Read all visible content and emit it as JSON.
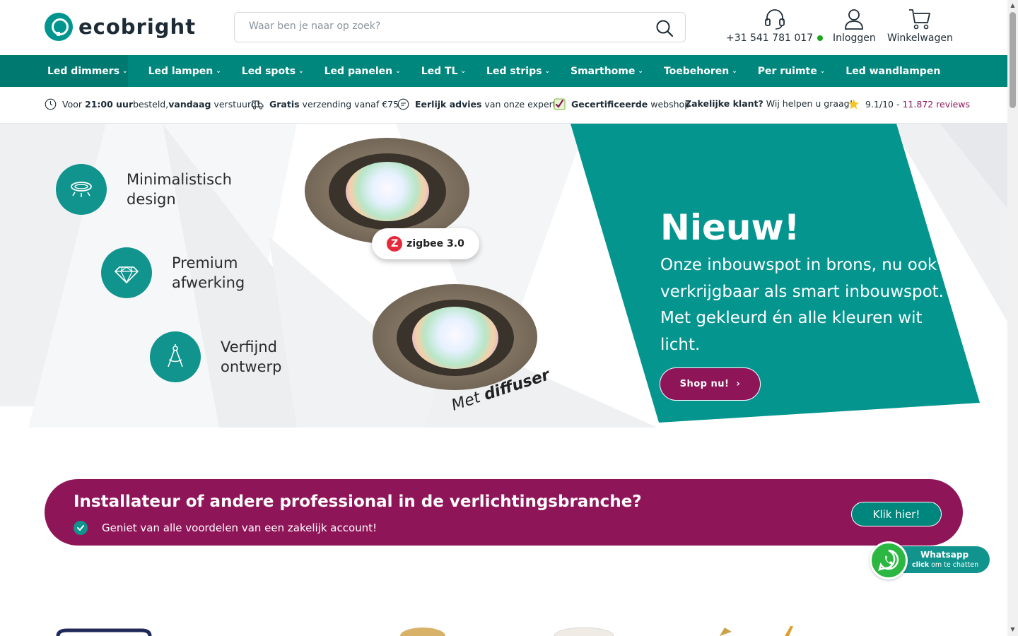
{
  "header": {
    "logo_text": "ecobright",
    "search_placeholder": "Waar ben je naar op zoek?",
    "phone": "+31 541 781 017",
    "login_label": "Inloggen",
    "cart_label": "Winkelwagen"
  },
  "nav": {
    "items": [
      {
        "label": "Led dimmers",
        "has_dropdown": true
      },
      {
        "label": "Led lampen",
        "has_dropdown": true
      },
      {
        "label": "Led spots",
        "has_dropdown": true
      },
      {
        "label": "Led panelen",
        "has_dropdown": true
      },
      {
        "label": "Led TL",
        "has_dropdown": true
      },
      {
        "label": "Led strips",
        "has_dropdown": true
      },
      {
        "label": "Smarthome",
        "has_dropdown": true
      },
      {
        "label": "Toebehoren",
        "has_dropdown": true
      },
      {
        "label": "Per ruimte",
        "has_dropdown": true
      },
      {
        "label": "Led wandlampen",
        "has_dropdown": false
      }
    ],
    "chevron": "⌄"
  },
  "usps": {
    "u1_pre": "Voor ",
    "u1_b1": "21:00 uur",
    "u1_mid": " besteld, ",
    "u1_b2": "vandaag",
    "u1_post": " verstuurd!",
    "u2_b": "Gratis",
    "u2_post": " verzending vanaf €75",
    "u3_b": "Eerlijk advies",
    "u3_post": " van onze experts",
    "u4_b": "Gecertificeerde",
    "u4_post": " webshop",
    "u5_b": "Zakelijke klant?",
    "u5_post": " Wij helpen u graag!",
    "u6_score": "9.1/10 -",
    "u6_reviews": "11.872 reviews"
  },
  "hero": {
    "features": [
      {
        "line1": "Minimalistisch",
        "line2": "design"
      },
      {
        "line1": "Premium",
        "line2": "afwerking"
      },
      {
        "line1": "Verfijnd",
        "line2": "ontwerp"
      }
    ],
    "zigbee_label": "zigbee 3.0",
    "diffuser_pre": "Met ",
    "diffuser_b": "diffuser",
    "title": "Nieuw!",
    "subtitle": "Onze inbouwspot in brons, nu ook verkrijgbaar als smart inbouwspot. Met gekleurd én alle kleuren wit licht.",
    "cta_label": "Shop nu!",
    "cta_arrow": "›"
  },
  "pro_banner": {
    "title": "Installateur of andere professional in de verlichtingsbranche?",
    "benefit": "Geniet van alle voordelen van een zakelijk account!",
    "button_label": "Klik hier!"
  },
  "whatsapp": {
    "title": "Whatsapp",
    "sub_b": "click",
    "sub_post": " om te chatten"
  },
  "colors": {
    "teal": "#00877d",
    "teal_hero": "#05958f",
    "magenta": "#8f1559",
    "online_green": "#19a61b"
  }
}
